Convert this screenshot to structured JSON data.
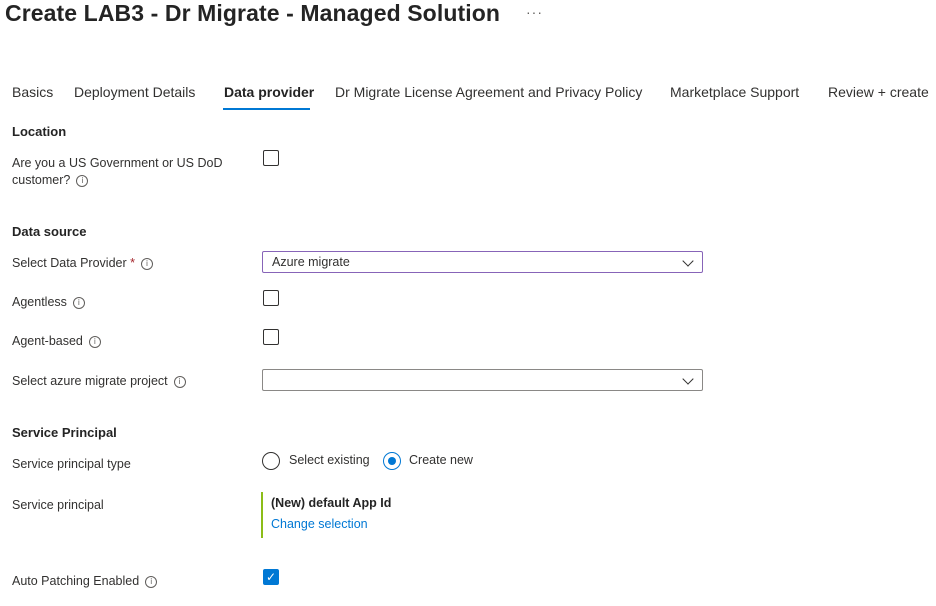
{
  "header": {
    "title": "Create LAB3 - Dr Migrate - Managed Solution",
    "more": "···"
  },
  "tabs": [
    {
      "label": "Basics"
    },
    {
      "label": "Deployment Details"
    },
    {
      "label": "Data provider"
    },
    {
      "label": "Dr Migrate License Agreement and Privacy Policy"
    },
    {
      "label": "Marketplace Support"
    },
    {
      "label": "Review + create"
    }
  ],
  "location": {
    "heading": "Location",
    "gov_label_line1": "Are you a US Government or US DoD",
    "gov_label_line2": "customer?",
    "gov_checked": false
  },
  "data_source": {
    "heading": "Data source",
    "provider_label": "Select Data Provider",
    "required_mark": "*",
    "provider_value": "Azure migrate",
    "agentless_label": "Agentless",
    "agentless_checked": false,
    "agent_based_label": "Agent-based",
    "agent_based_checked": false,
    "project_label": "Select azure migrate project",
    "project_value": ""
  },
  "service_principal": {
    "heading": "Service Principal",
    "type_label": "Service principal type",
    "option_existing": "Select existing",
    "option_new": "Create new",
    "selected": "Create new",
    "sp_label": "Service principal",
    "sp_name": "(New) default App Id",
    "change_link": "Change selection"
  },
  "auto_patching": {
    "label": "Auto Patching Enabled",
    "checked": true
  },
  "icons": {
    "info": "info-icon",
    "check": "checkmark-icon",
    "chevron": "chevron-down-icon"
  },
  "colors": {
    "accent": "#0078d4",
    "sp_bar": "#8cbd18",
    "required": "#a4262c"
  }
}
